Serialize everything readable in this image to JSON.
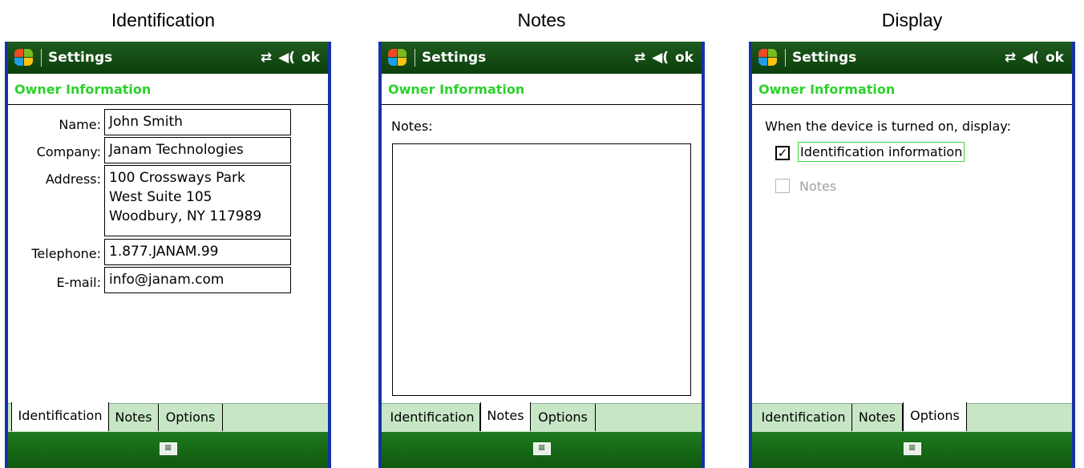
{
  "captions": [
    "Identification",
    "Notes",
    "Display"
  ],
  "titlebar": {
    "title": "Settings",
    "status_icons": [
      "⇄",
      "◀(",
      "ok"
    ]
  },
  "header": {
    "title": "Owner Information"
  },
  "tabs": [
    "Identification",
    "Notes",
    "Options"
  ],
  "identification": {
    "name_label": "Name:",
    "name_value": "John Smith",
    "company_label": "Company:",
    "company_value": "Janam Technologies",
    "address_label": "Address:",
    "address_lines": [
      "100 Crossways Park",
      "West Suite 105",
      "Woodbury, NY 117989"
    ],
    "telephone_label": "Telephone:",
    "telephone_value": "1.877.JANAM.99",
    "email_label": "E-mail:",
    "email_value": "info@janam.com"
  },
  "notes": {
    "label": "Notes:",
    "value": ""
  },
  "display": {
    "prompt": "When the device is turned on, display:",
    "option_identification": "Identification information",
    "option_identification_checked": true,
    "option_notes": "Notes",
    "option_notes_checked": false
  }
}
